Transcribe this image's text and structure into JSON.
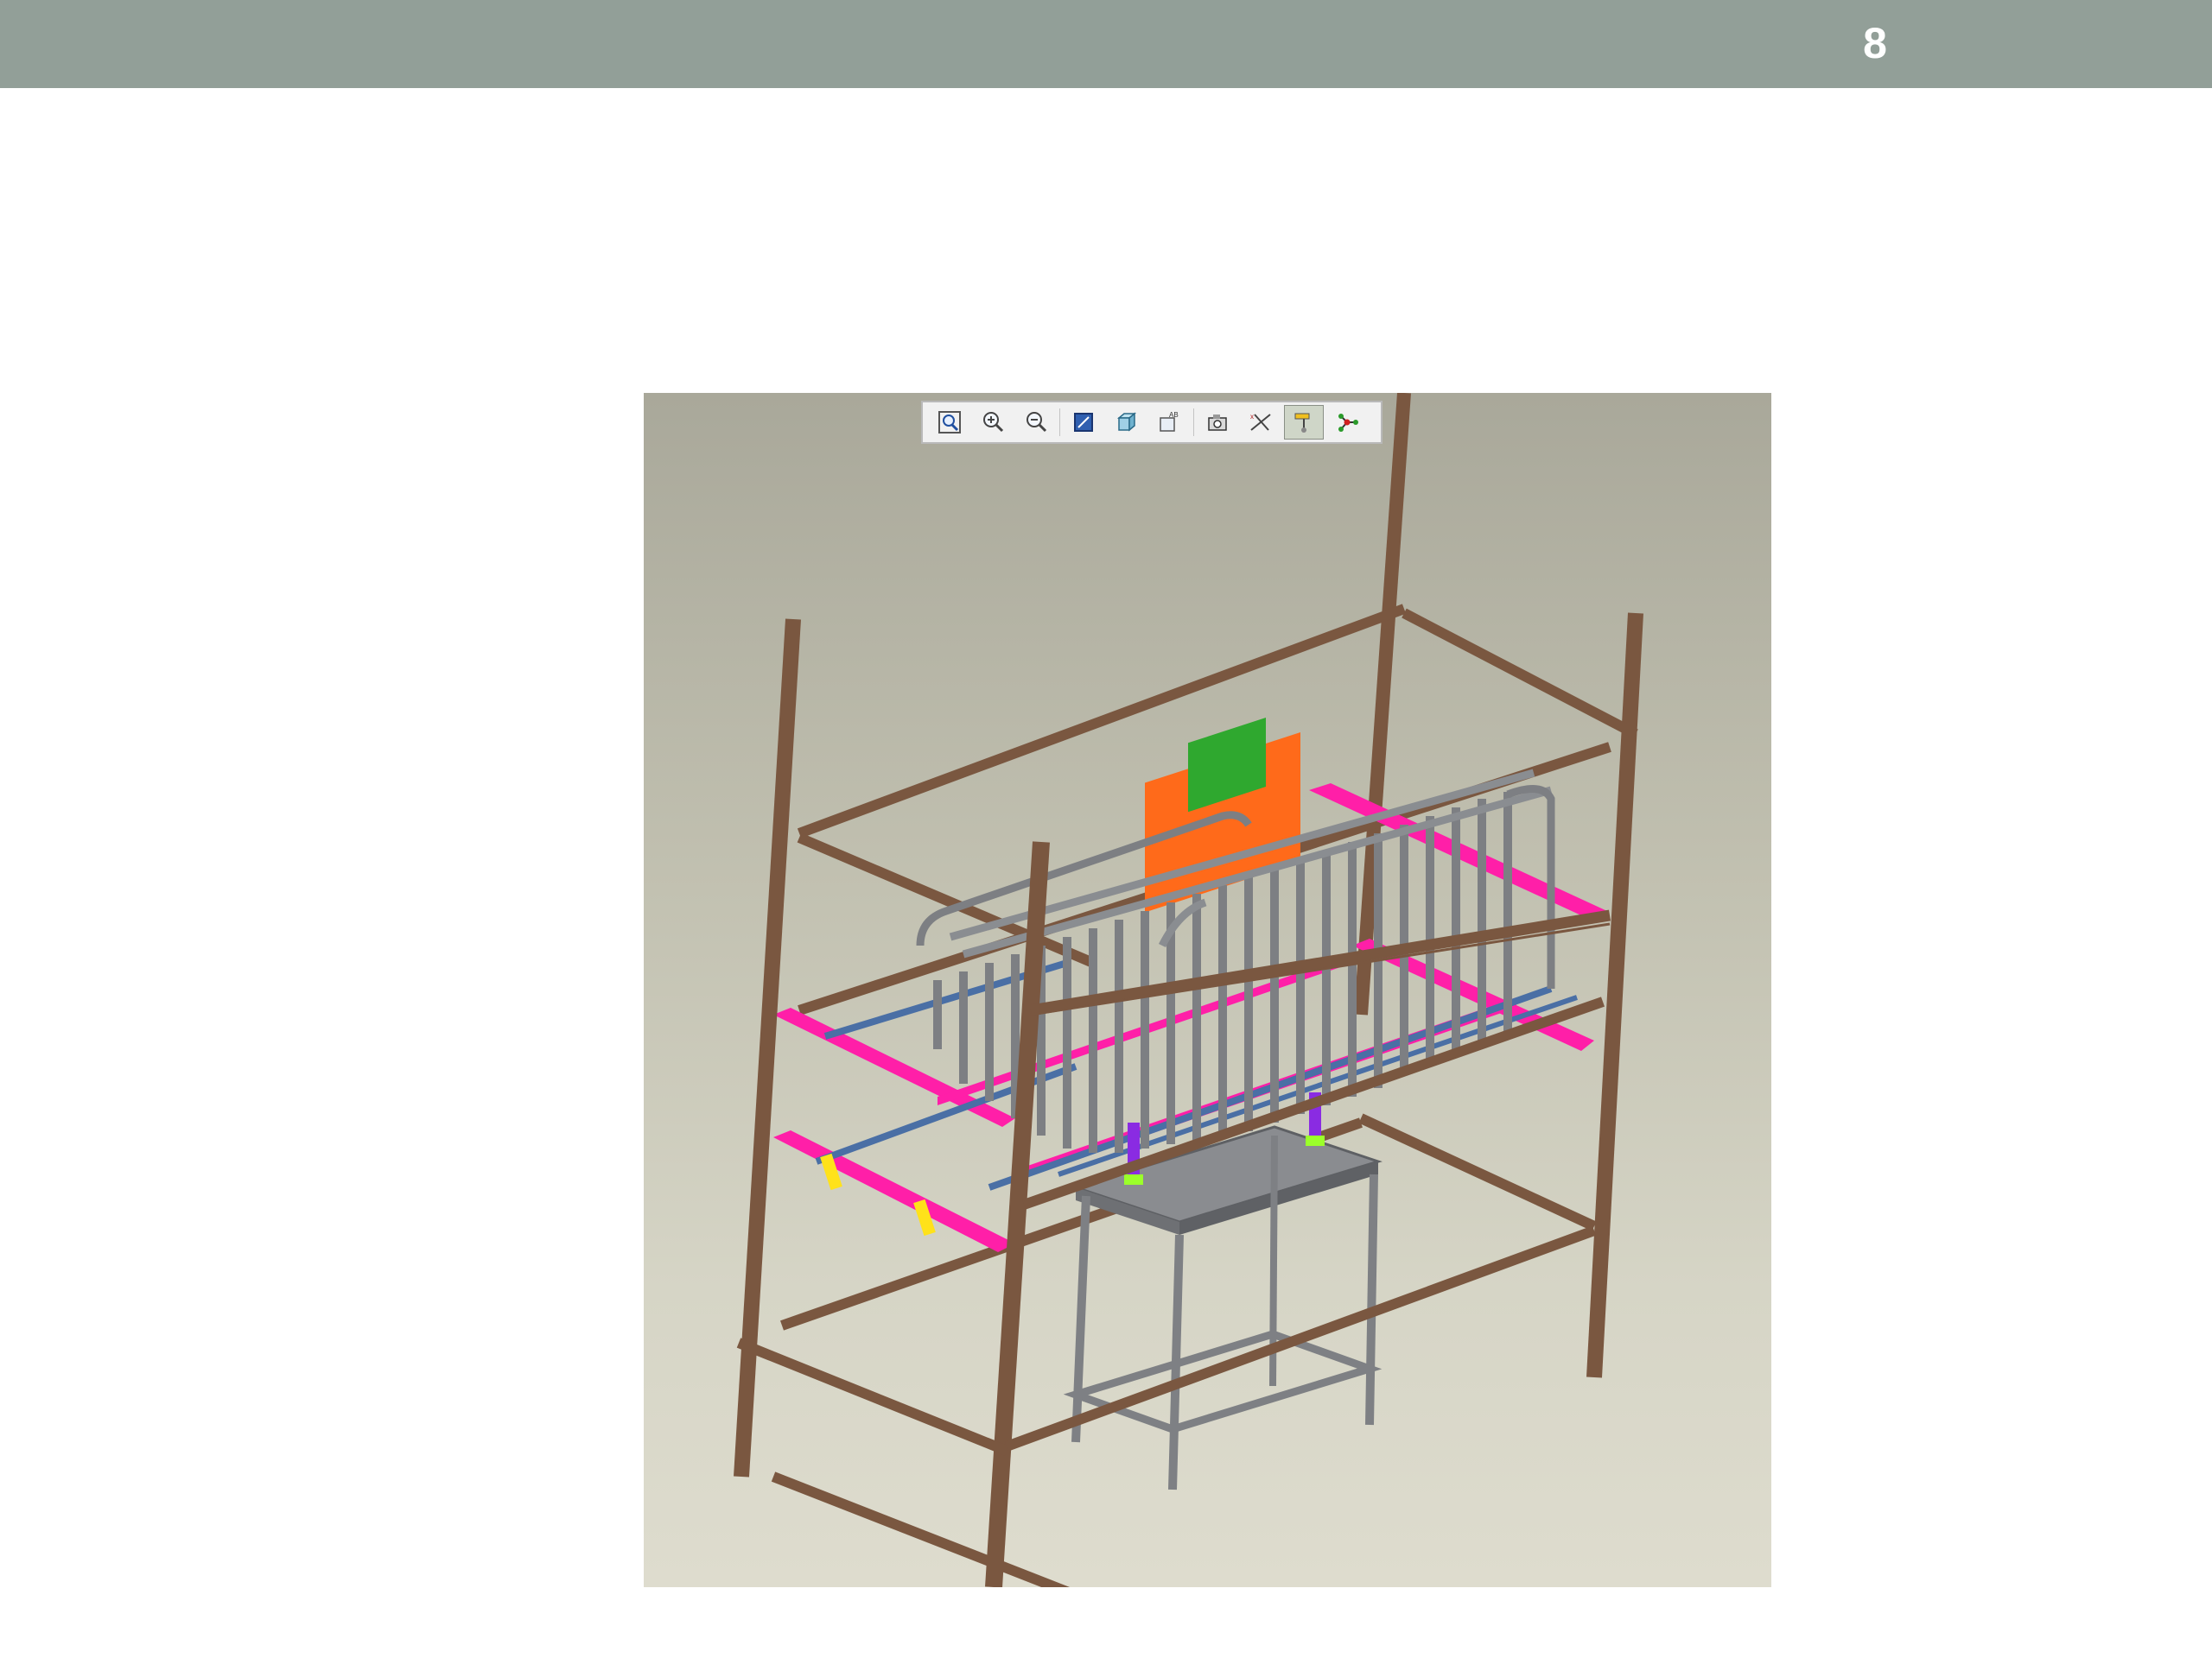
{
  "slide": {
    "page_number": "8",
    "header_color": "#929f98"
  },
  "viewport": {
    "background_top": "#a9a89a",
    "background_bottom": "#dedcce",
    "toolbar": {
      "buttons": [
        {
          "icon": "zoom-fit-icon",
          "active": false
        },
        {
          "icon": "zoom-in-icon",
          "active": false
        },
        {
          "icon": "zoom-out-icon",
          "active": false
        },
        {
          "icon": "repaint-icon",
          "active": false
        },
        {
          "icon": "display-style-icon",
          "active": false
        },
        {
          "icon": "saved-views-icon",
          "active": false
        },
        {
          "icon": "datum-display-icon",
          "active": false
        },
        {
          "icon": "csys-display-icon",
          "active": false
        },
        {
          "icon": "annotation-display-icon",
          "active": true
        },
        {
          "icon": "spin-center-icon",
          "active": false
        }
      ]
    },
    "model_colors": {
      "wood_frame": "#7a5740",
      "magenta_rails": "#ff1fa8",
      "blue_rails": "#4a6fa5",
      "gray_tubes": "#7d7f83",
      "orange_parts": "#ff6a1a",
      "green_parts": "#2fa82f",
      "purple_brackets": "#8a2be2",
      "lime_brackets": "#9bff2a",
      "yellow_clamps": "#ffe21a",
      "table_frame": "#7e8084"
    }
  }
}
